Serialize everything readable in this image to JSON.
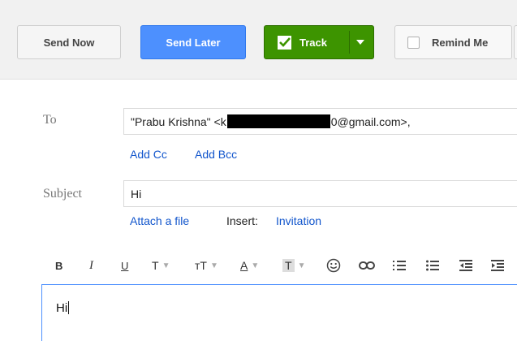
{
  "toolbar": {
    "send_now": "Send Now",
    "send_later": "Send Later",
    "track": "Track",
    "remind_me": "Remind Me"
  },
  "to": {
    "label": "To",
    "value_prefix": "\"Prabu Krishna\" <k",
    "value_suffix": "0@gmail.com>,",
    "add_cc": "Add Cc",
    "add_bcc": "Add Bcc"
  },
  "subject": {
    "label": "Subject",
    "value": "Hi",
    "attach": "Attach a file",
    "insert_label": "Insert:",
    "invitation": "Invitation"
  },
  "format_toolbar": {
    "bold": "B",
    "italic": "I",
    "underline": "U",
    "font": "T",
    "size": "тT",
    "text_color": "A",
    "highlight": "T"
  },
  "body": {
    "text": "Hi"
  },
  "colors": {
    "send_later": "#4d90fe",
    "track": "#3d9400",
    "link": "#1155cc",
    "focus_border": "#4d90fe"
  }
}
